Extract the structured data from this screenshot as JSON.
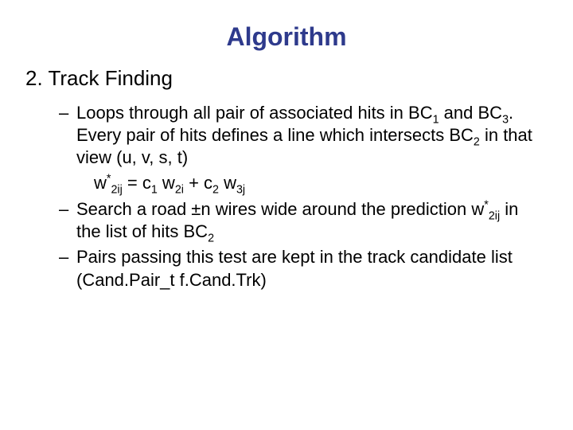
{
  "title": "Algorithm",
  "section": "2. Track Finding",
  "b1_a": "Loops through all pair of associated hits in BC",
  "b1_n1": "1",
  "b1_b": " and BC",
  "b1_n2": "3",
  "b1_c": ". Every pair of hits defines a line which intersects BC",
  "b1_n3": "2",
  "b1_d": " in that view (u, v, s, t)",
  "f_w": "w",
  "f_star": "*",
  "f_2ij": "2ij",
  "f_eq": " = c",
  "f_c1": "1",
  "f_sp_w": " w",
  "f_2i": "2i",
  "f_plus_c": " + c",
  "f_c2": "2",
  "f_3j": "3j",
  "b2_a": "Search a road ±n wires wide around the prediction w",
  "b2_b": " in the list of hits BC",
  "b2_n": "2",
  "b3": "Pairs passing this test are kept in the track candidate list (Cand.Pair_t f.Cand.Trk)"
}
